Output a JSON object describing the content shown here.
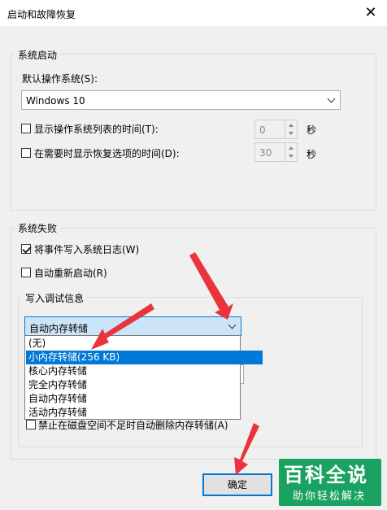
{
  "window": {
    "title": "启动和故障恢复"
  },
  "startup": {
    "group_label": "系统启动",
    "default_os_label": "默认操作系统(S):",
    "default_os_value": "Windows 10",
    "show_list_label": "显示操作系统列表的时间(T):",
    "show_list_checked": false,
    "show_list_value": "0",
    "show_recovery_label": "在需要时显示恢复选项的时间(D):",
    "show_recovery_checked": false,
    "show_recovery_value": "30",
    "seconds_unit": "秒"
  },
  "failure": {
    "group_label": "系统失败",
    "write_event_label": "将事件写入系统日志(W)",
    "write_event_checked": true,
    "auto_restart_label": "自动重新启动(R)",
    "auto_restart_checked": false,
    "debug_group_label": "写入调试信息",
    "debug_selected": "自动内存转储",
    "debug_options": [
      "(无)",
      "小内存转储(256 KB)",
      "核心内存转储",
      "完全内存转储",
      "自动内存转储",
      "活动内存转储"
    ],
    "debug_highlighted_index": 1,
    "disable_delete_label": "禁止在磁盘空间不足时自动删除内存转储(A)"
  },
  "buttons": {
    "ok_label": "确定"
  },
  "watermark": {
    "main": "百科全说",
    "sub": "助你轻松解决"
  },
  "colors": {
    "accent": "#0078d7",
    "arrow": "#e8353b",
    "watermark_bg": "#1aa260"
  }
}
